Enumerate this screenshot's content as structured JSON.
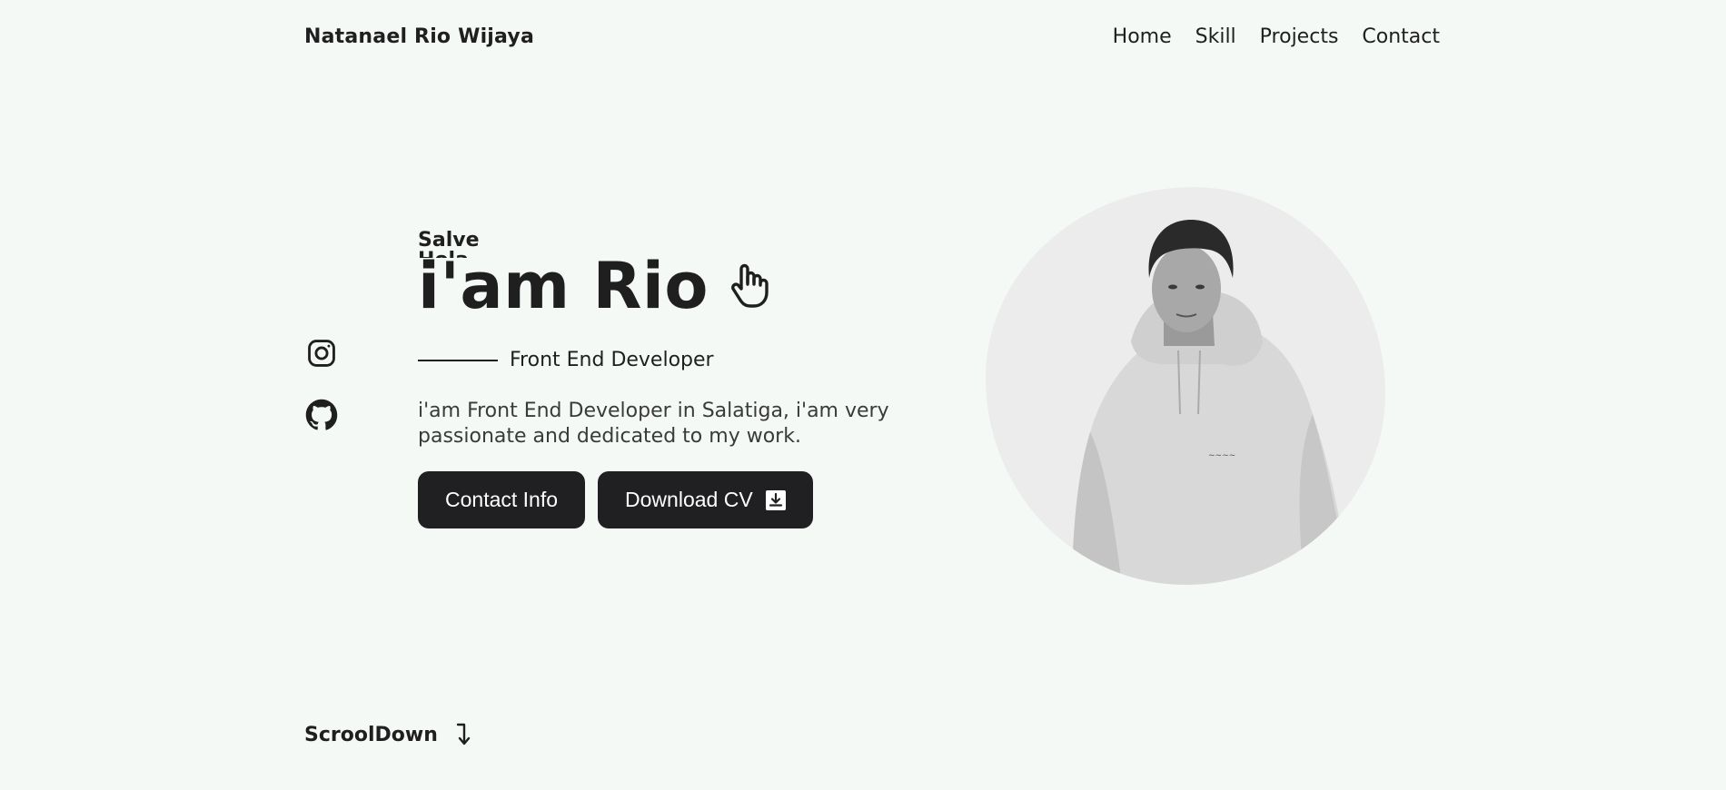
{
  "header": {
    "brand": "Natanael Rio Wijaya",
    "nav": [
      "Home",
      "Skill",
      "Projects",
      "Contact"
    ]
  },
  "socials": [
    {
      "icon": "instagram-icon"
    },
    {
      "icon": "github-icon"
    }
  ],
  "hero": {
    "greetings": [
      "Salve",
      "Hola"
    ],
    "title": "i'am Rio",
    "title_icon": "hand-pointer-icon",
    "subtitle": "Front End Developer",
    "description": "i'am Front End Developer in Salatiga, i'am very passionate and dedicated to my work.",
    "buttons": {
      "contact": "Contact Info",
      "download": "Download CV",
      "download_icon": "download-icon"
    }
  },
  "scroll": {
    "label": "ScroolDown",
    "icon": "arrow-down-icon"
  },
  "colors": {
    "background": "#f5f9f6",
    "text": "#1f1f1f",
    "button": "#202022",
    "photo_bg": "#ececec"
  }
}
